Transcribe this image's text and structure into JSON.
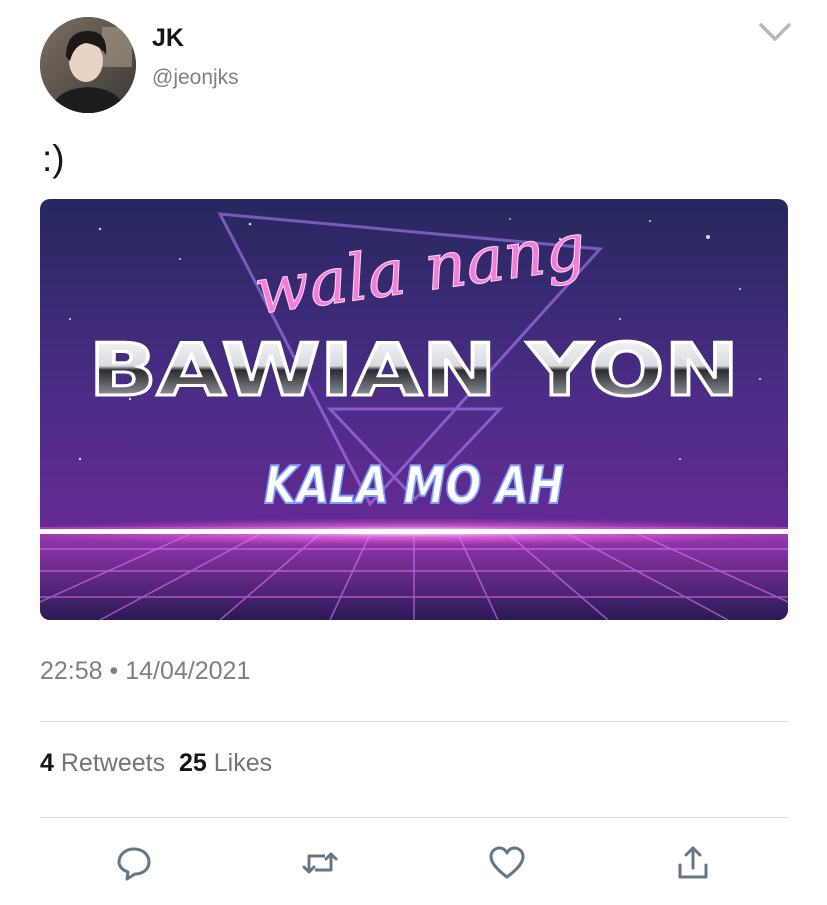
{
  "user": {
    "display_name": "JK",
    "handle": "@jeonjks"
  },
  "tweet": {
    "text": ":)",
    "time": "22:58",
    "separator": "•",
    "date": "14/04/2021"
  },
  "media": {
    "line1": "wala nang",
    "line2": "BAWIAN YON",
    "line3": "KALA MO AH"
  },
  "stats": {
    "retweets_count": "4",
    "retweets_label": "Retweets",
    "likes_count": "25",
    "likes_label": "Likes"
  },
  "icons": {
    "caret": "chevron-down-icon",
    "reply": "reply-icon",
    "retweet": "retweet-icon",
    "like": "heart-icon",
    "share": "share-icon"
  },
  "colors": {
    "icon_gray": "#657786",
    "text_primary": "#14171a",
    "text_secondary": "#7b8186",
    "divider": "#d5dbe0"
  }
}
